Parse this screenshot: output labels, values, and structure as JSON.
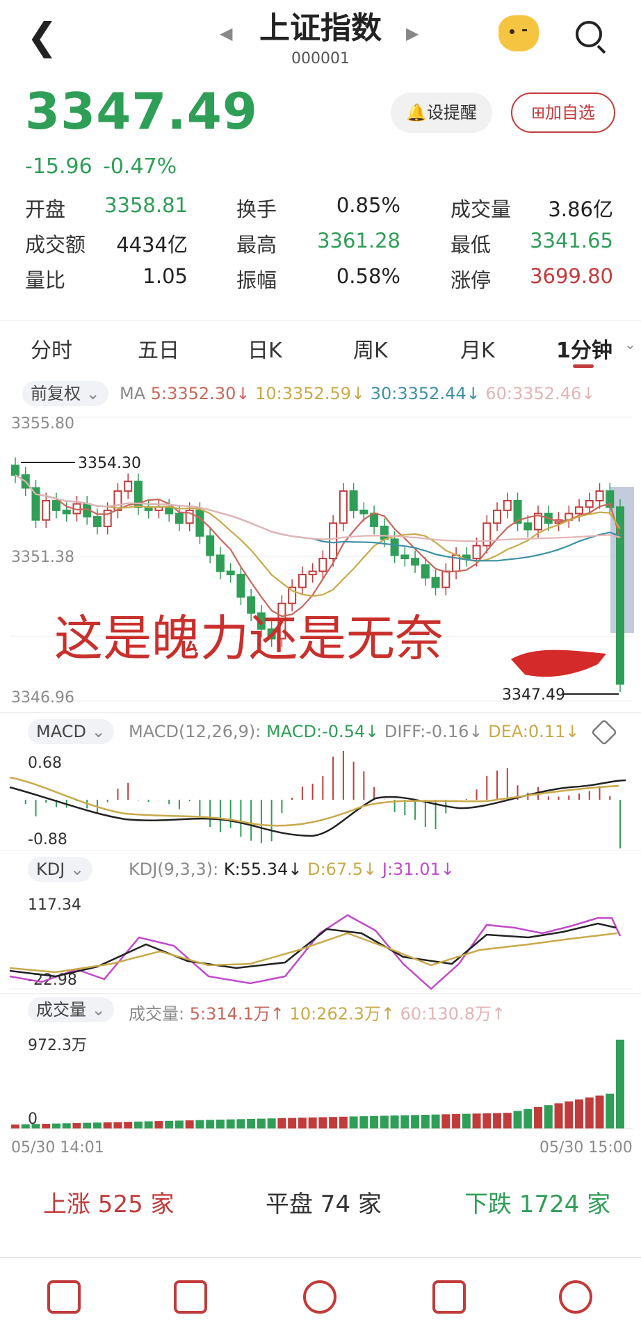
{
  "header": {
    "title": "上证指数",
    "code": "000001"
  },
  "quote": {
    "price": "3347.49",
    "change": "-15.96",
    "change_pct": "-0.47%",
    "alert_label": "设提醒",
    "watch_label": "加自选"
  },
  "stats": [
    {
      "label": "开盘",
      "value": "3358.81",
      "color": "#2f9e57"
    },
    {
      "label": "换手",
      "value": "0.85%",
      "color": "#222222"
    },
    {
      "label": "成交量",
      "value": "3.86亿",
      "color": "#222222"
    },
    {
      "label": "成交额",
      "value": "4434亿",
      "color": "#222222"
    },
    {
      "label": "最高",
      "value": "3361.28",
      "color": "#2f9e57"
    },
    {
      "label": "最低",
      "value": "3341.65",
      "color": "#2f9e57"
    },
    {
      "label": "量比",
      "value": "1.05",
      "color": "#222222"
    },
    {
      "label": "振幅",
      "value": "0.58%",
      "color": "#222222"
    },
    {
      "label": "涨停",
      "value": "3699.80",
      "color": "#c23b3b"
    }
  ],
  "tabs": [
    "分时",
    "五日",
    "日K",
    "周K",
    "月K",
    "1分钟"
  ],
  "active_tab": "1分钟",
  "main_chart": {
    "adjust_label": "前复权",
    "ma_prefix": "MA",
    "ma": [
      {
        "text": "5:3352.30↓",
        "color": "#c8675a"
      },
      {
        "text": "10:3352.59↓",
        "color": "#c9a94a"
      },
      {
        "text": "30:3352.44↓",
        "color": "#3e8fa6"
      },
      {
        "text": "60:3352.46↓",
        "color": "#e3b4b4"
      }
    ],
    "y_top": "3355.80",
    "y_mid": "3351.38",
    "y_bottom": "3346.96",
    "high_marker": "3354.30",
    "last_marker": "3347.49",
    "annotation": "这是魄力还是无奈"
  },
  "macd": {
    "label": "MACD",
    "params": "MACD(12,26,9):",
    "macd": "MACD:-0.54↓",
    "diff": "DIFF:-0.16↓",
    "dea": "DEA:0.11↓",
    "y_top": "0.68",
    "y_bottom": "-0.88"
  },
  "kdj": {
    "label": "KDJ",
    "params": "KDJ(9,3,3):",
    "k": "K:55.34↓",
    "d": "D:67.5↓",
    "j": "J:31.01↓",
    "y_top": "117.34",
    "y_bottom": "-22.98"
  },
  "volume": {
    "label": "成交量",
    "prefix": "成交量:",
    "ma5": "5:314.1万↑",
    "ma10": "10:262.3万↑",
    "ma60": "60:130.8万↑",
    "y_top": "972.3万",
    "y_bottom": "0",
    "time_start": "05/30 14:01",
    "time_end": "05/30 15:00"
  },
  "breadth": {
    "up": "上涨 525 家",
    "flat": "平盘 74 家",
    "down": "下跌 1724 家"
  },
  "chart_data": {
    "type": "candlestick",
    "title": "",
    "x_range": [
      "05/30 14:01",
      "05/30 15:00"
    ],
    "ylim": [
      3346.96,
      3355.8
    ],
    "close_approx": [
      3354.0,
      3353.6,
      3352.6,
      3353.2,
      3352.9,
      3352.8,
      3353.1,
      3352.7,
      3352.4,
      3352.9,
      3353.5,
      3353.8,
      3353.0,
      3352.9,
      3353.0,
      3352.8,
      3352.5,
      3352.9,
      3352.1,
      3351.5,
      3351.0,
      3350.9,
      3350.2,
      3349.7,
      3349.2,
      3348.9,
      3350.0,
      3350.5,
      3350.9,
      3351.0,
      3351.4,
      3352.5,
      3353.5,
      3352.9,
      3352.8,
      3352.4,
      3352.0,
      3351.5,
      3351.4,
      3351.2,
      3350.8,
      3350.5,
      3351.0,
      3351.5,
      3351.4,
      3351.8,
      3352.5,
      3352.9,
      3353.2,
      3352.5,
      3352.3,
      3352.8,
      3352.5,
      3352.6,
      3352.8,
      3353.0,
      3353.2,
      3353.5,
      3353.0,
      3347.49
    ],
    "macd_range": [
      -0.88,
      0.68
    ],
    "kdj_range": [
      -22.98,
      117.34
    ],
    "volume_range_wan": [
      0,
      972.3
    ]
  }
}
